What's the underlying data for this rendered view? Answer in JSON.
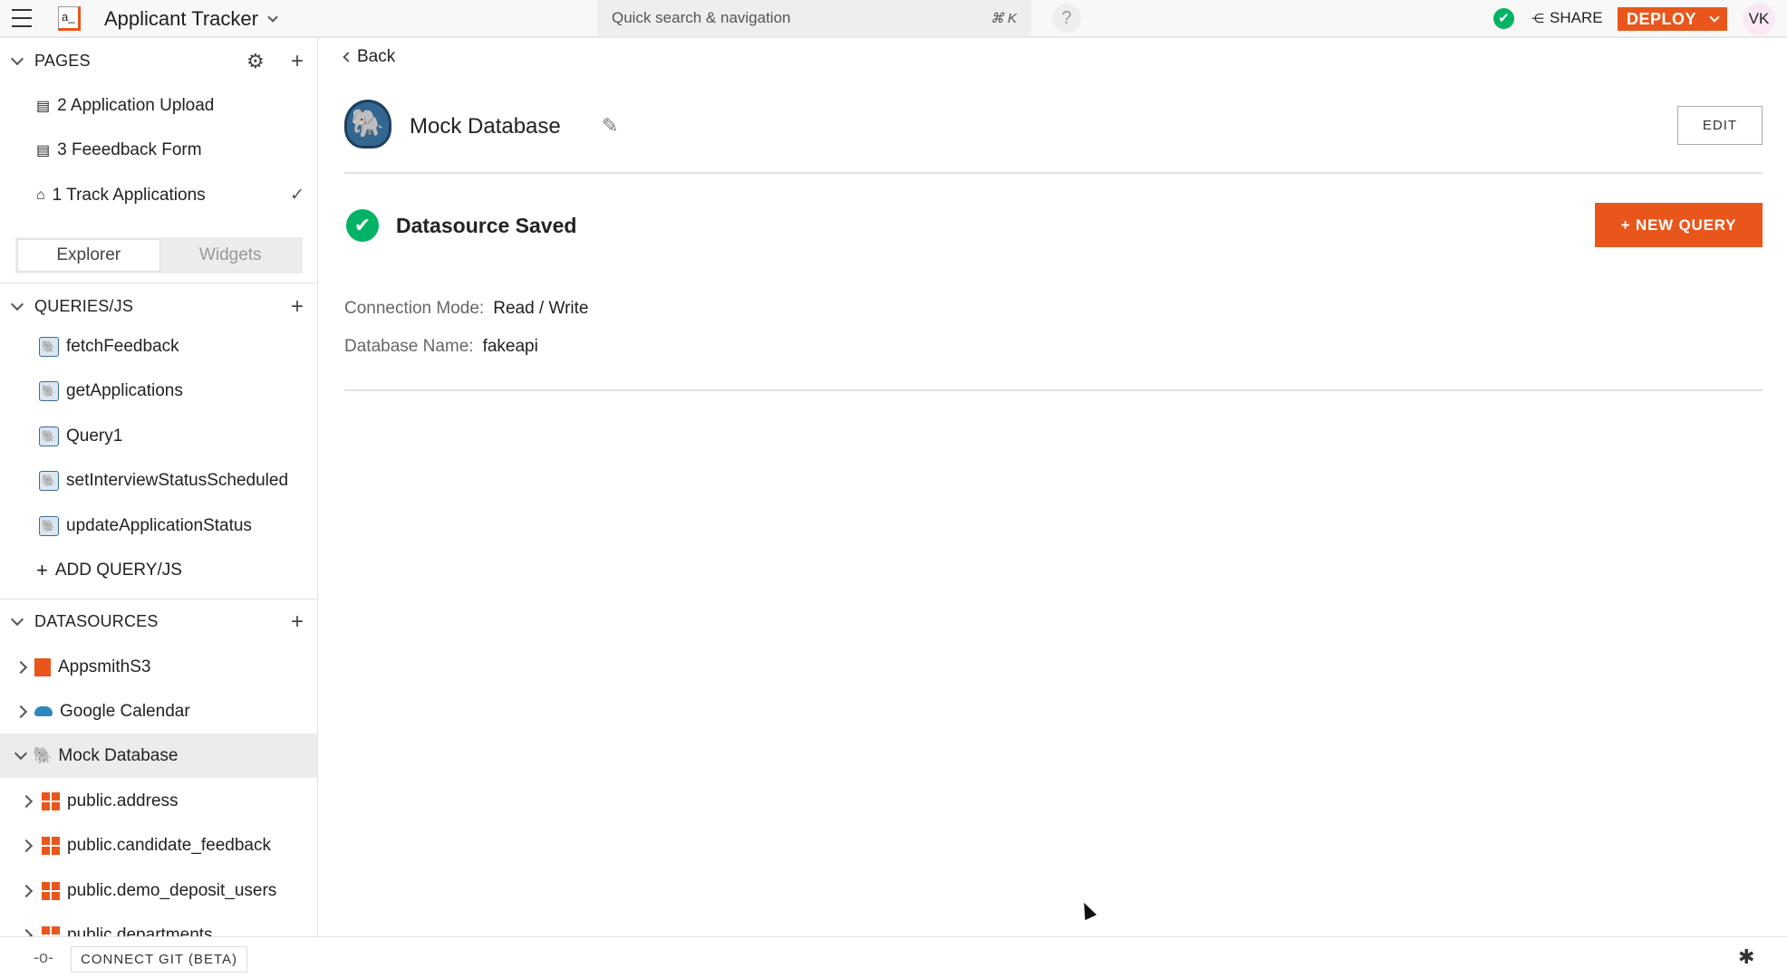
{
  "header": {
    "app_title": "Applicant Tracker",
    "logo_text": "a_",
    "search_placeholder": "Quick search & navigation",
    "search_shortcut": "⌘ K",
    "help": "?",
    "share": "SHARE",
    "deploy": "DEPLOY",
    "avatar": "VK",
    "accent": "#e8561b"
  },
  "sidebar": {
    "pages_title": "PAGES",
    "pages": [
      {
        "label": "2 Application Upload"
      },
      {
        "label": "3 Feeedback Form"
      },
      {
        "label": "1 Track Applications"
      }
    ],
    "tabs": [
      "Explorer",
      "Widgets"
    ],
    "queries_title": "QUERIES/JS",
    "queries": [
      "fetchFeedback",
      "getApplications",
      "Query1",
      "setInterviewStatusScheduled",
      "updateApplicationStatus"
    ],
    "add_query": "ADD QUERY/JS",
    "datasources_title": "DATASOURCES",
    "datasources": [
      "AppsmithS3",
      "Google Calendar",
      "Mock Database"
    ],
    "tables": [
      "public.address",
      "public.candidate_feedback",
      "public.demo_deposit_users",
      "public.departments"
    ]
  },
  "main": {
    "back": "Back",
    "title": "Mock Database",
    "edit": "EDIT",
    "saved": "Datasource Saved",
    "new_query": "+ NEW QUERY",
    "fields": [
      {
        "label": "Connection Mode:",
        "value": "Read / Write"
      },
      {
        "label": "Database Name:",
        "value": "fakeapi"
      }
    ]
  },
  "footer": {
    "connect_git": "CONNECT GIT (BETA)"
  }
}
